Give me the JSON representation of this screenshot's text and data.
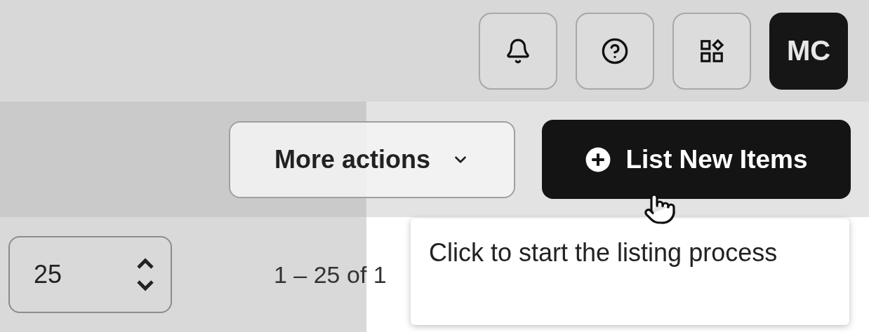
{
  "header": {
    "buttons": [
      {
        "kind": "notifications"
      },
      {
        "kind": "help"
      },
      {
        "kind": "apps"
      }
    ],
    "avatar": {
      "initials": "MC"
    }
  },
  "actions": {
    "more_actions": {
      "label": "More actions"
    },
    "primary": {
      "label": "List New Items"
    }
  },
  "tooltip": {
    "text": "Click to start the listing process"
  },
  "pagination": {
    "page_size": "25",
    "range": "1 – 25 of 1"
  }
}
